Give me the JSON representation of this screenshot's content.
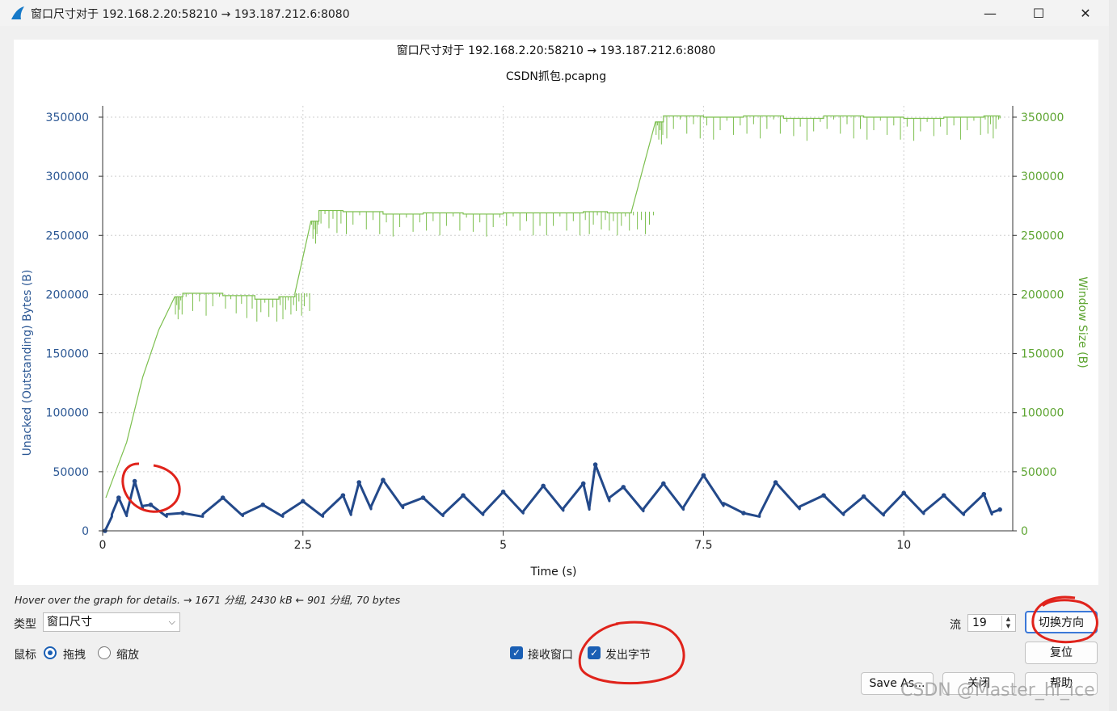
{
  "window": {
    "title": "窗口尺寸对于 192.168.2.20:58210 → 193.187.212.6:8080",
    "minimize_glyph": "—",
    "maximize_glyph": "☐",
    "close_glyph": "✕"
  },
  "chart_data": {
    "type": "line",
    "title": "窗口尺寸对于 192.168.2.20:58210 → 193.187.212.6:8080",
    "subtitle": "CSDN抓包.pcapng",
    "xlabel": "Time (s)",
    "ylabel_left": "Unacked (Outstanding) Bytes (B)",
    "ylabel_right": "Window Size (B)",
    "xlim": [
      0,
      11.3
    ],
    "ylim": [
      0,
      350000
    ],
    "x_ticks": [
      "0",
      "2.5",
      "5",
      "7.5",
      "10"
    ],
    "y_ticks": [
      "0",
      "50000",
      "100000",
      "150000",
      "200000",
      "250000",
      "300000",
      "350000"
    ],
    "grid": true,
    "series": [
      {
        "name": "Window Size (B)",
        "color": "#7cbf4e",
        "style": "step-line",
        "x": [
          0.04,
          0.3,
          0.5,
          0.7,
          0.9,
          1.0,
          1.5,
          1.9,
          2.2,
          2.4,
          2.6,
          2.7,
          3.0,
          3.5,
          4.0,
          4.5,
          5.0,
          5.5,
          6.0,
          6.3,
          6.6,
          6.9,
          7.0,
          7.5,
          8.0,
          8.5,
          9.0,
          9.5,
          10.0,
          10.5,
          11.0,
          11.2
        ],
        "y": [
          28000,
          75000,
          130000,
          170000,
          198000,
          201000,
          199000,
          196000,
          198000,
          201000,
          262000,
          271000,
          270000,
          268000,
          269000,
          268000,
          269000,
          269000,
          270000,
          269000,
          270000,
          346000,
          351000,
          350000,
          351000,
          349000,
          351000,
          350000,
          349000,
          350000,
          351000,
          349000
        ]
      },
      {
        "name": "Unacked (Outstanding) Bytes (B)",
        "color": "#23498a",
        "style": "sawtooth-points",
        "x": [
          0.03,
          0.2,
          0.4,
          0.6,
          1.0,
          1.5,
          2.0,
          2.5,
          3.0,
          3.2,
          3.5,
          4.0,
          4.5,
          5.0,
          5.5,
          6.0,
          6.15,
          6.5,
          7.0,
          7.5,
          8.0,
          8.4,
          9.0,
          9.5,
          10.0,
          10.5,
          11.0,
          11.2
        ],
        "y": [
          0,
          28000,
          42000,
          22000,
          15000,
          28000,
          22000,
          25000,
          30000,
          41000,
          43000,
          28000,
          30000,
          33000,
          38000,
          40000,
          56000,
          37000,
          40000,
          47000,
          15000,
          41000,
          30000,
          29000,
          32000,
          30000,
          31000,
          18000
        ]
      }
    ]
  },
  "status": "Hover over the graph for details. → 1671 分组, 2430 kB ← 901 分组, 70 bytes",
  "controls": {
    "type_label": "类型",
    "type_value": "窗口尺寸",
    "mouse_label": "鼠标",
    "drag_label": "拖拽",
    "zoom_label": "缩放",
    "recv_window_label": "接收窗口",
    "bytes_out_label": "发出字节",
    "stream_label": "流",
    "stream_value": "19",
    "switch_direction": "切换方向",
    "reset": "复位",
    "save_as": "Save As...",
    "close": "关闭",
    "help": "帮助"
  },
  "watermark": "CSDN @Master_hl_ice"
}
